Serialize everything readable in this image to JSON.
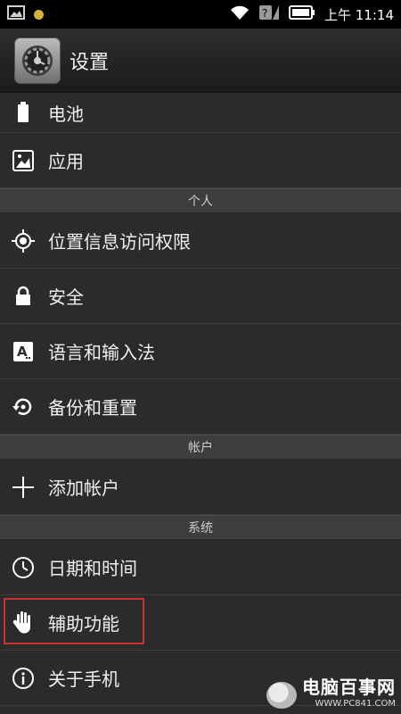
{
  "statusbar": {
    "time": "上午 11:14"
  },
  "actionbar": {
    "title": "设置"
  },
  "items": {
    "battery": "电池",
    "apps": "应用",
    "personal_header": "个人",
    "location": "位置信息访问权限",
    "security": "安全",
    "language": "语言和输入法",
    "backup": "备份和重置",
    "accounts_header": "帐户",
    "add_account": "添加帐户",
    "system_header": "系统",
    "datetime": "日期和时间",
    "accessibility": "辅助功能",
    "about": "关于手机"
  },
  "watermark": {
    "main": "电脑百事网",
    "sub": "WWW.PC841.COM"
  },
  "colors": {
    "highlight": "#c8312e",
    "background": "#2b2b2b"
  }
}
